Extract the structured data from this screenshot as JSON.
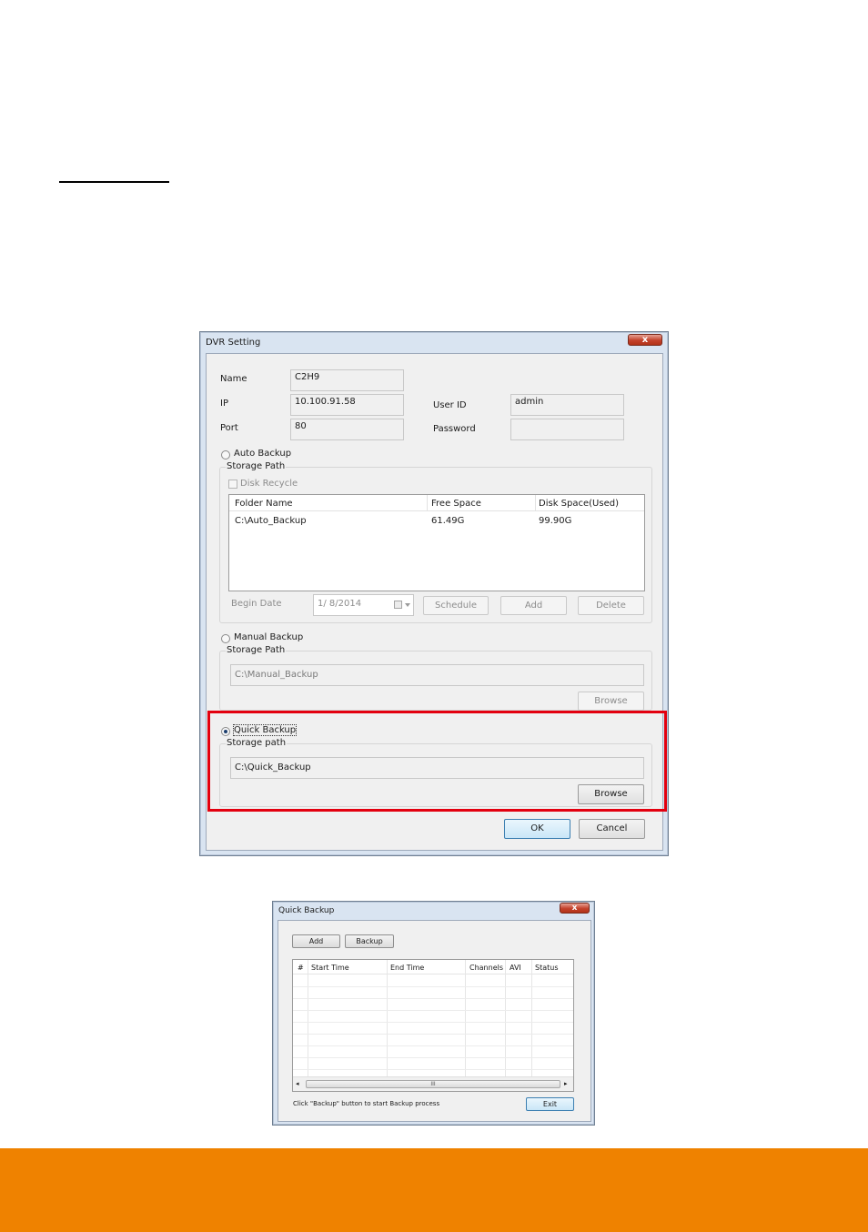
{
  "colors": {
    "footer": "#ef8200",
    "highlight": "#e3000f",
    "window_frame": "#d9e4f1"
  },
  "dvr_window": {
    "title": "DVR Setting",
    "close_glyph": "x",
    "name_label": "Name",
    "name_value": "C2H9",
    "ip_label": "IP",
    "ip_value": "10.100.91.58",
    "port_label": "Port",
    "port_value": "80",
    "userid_label": "User ID",
    "userid_value": "admin",
    "password_label": "Password",
    "password_value": "",
    "auto_backup": {
      "label": "Auto Backup",
      "storage_label": "Storage Path",
      "disk_recycle": "Disk Recycle",
      "columns": [
        "Folder Name",
        "Free Space",
        "Disk Space(Used)"
      ],
      "rows": [
        {
          "folder": "C:\\Auto_Backup",
          "free": "61.49G",
          "used": "99.90G"
        }
      ],
      "begin_date_label": "Begin Date",
      "begin_date_value": "1/  8/2014",
      "schedule_button": "Schedule",
      "add_button": "Add",
      "delete_button": "Delete"
    },
    "manual_backup": {
      "label": "Manual Backup",
      "storage_label": "Storage Path",
      "path": "C:\\Manual_Backup",
      "browse_button": "Browse"
    },
    "quick_backup": {
      "label": "Quick Backup",
      "selected": true,
      "storage_label": "Storage path",
      "path": "C:\\Quick_Backup",
      "browse_button": "Browse"
    },
    "ok_button": "OK",
    "cancel_button": "Cancel"
  },
  "quick_window": {
    "title": "Quick Backup",
    "close_glyph": "x",
    "add_button": "Add",
    "backup_button": "Backup",
    "columns": [
      "#",
      "Start Time",
      "End Time",
      "Channels",
      "AVI",
      "Status"
    ],
    "scroll_left": "◂",
    "scroll_right": "▸",
    "scroll_grip": "III",
    "hint": "Click \"Backup\" button to start Backup process",
    "exit_button": "Exit"
  }
}
